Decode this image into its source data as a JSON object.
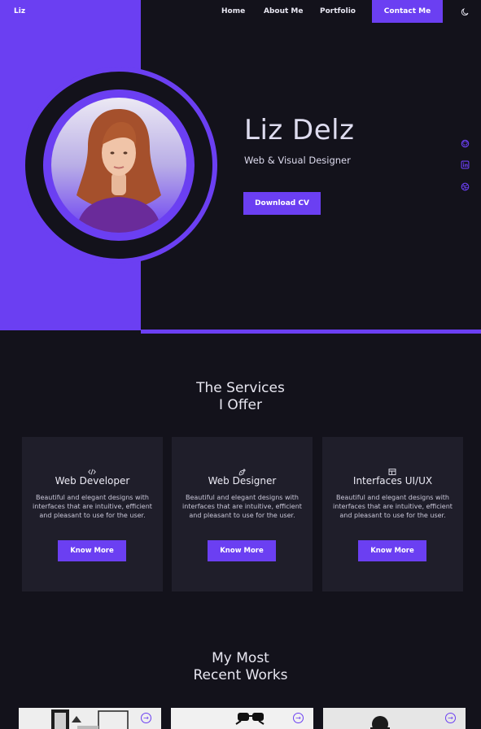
{
  "header": {
    "logo": "Liz",
    "nav": [
      "Home",
      "About Me",
      "Portfolio"
    ],
    "contact_label": "Contact Me",
    "theme_icon": "moon-icon"
  },
  "hero": {
    "name": "Liz Delz",
    "role": "Web & Visual Designer",
    "cta_label": "Download CV",
    "social_icons": [
      "github-icon",
      "linkedin-icon",
      "dribbble-icon"
    ]
  },
  "services": {
    "title_line1": "The Services",
    "title_line2": "I Offer",
    "cards": [
      {
        "icon": "code-icon",
        "title": "Web Developer",
        "text": "Beautiful and elegant designs with interfaces that are intuitive, efficient and pleasant to use for the user.",
        "button": "Know More"
      },
      {
        "icon": "pen-tool-icon",
        "title": "Web Designer",
        "text": "Beautiful and elegant designs with interfaces that are intuitive, efficient and pleasant to use for the user.",
        "button": "Know More"
      },
      {
        "icon": "layout-icon",
        "title": "Interfaces UI/UX",
        "text": "Beautiful and elegant designs with interfaces that are intuitive, efficient and pleasant to use for the user.",
        "button": "Know More"
      }
    ]
  },
  "works": {
    "title_line1": "My Most",
    "title_line2": "Recent Works",
    "items": [
      {
        "arrow_icon": "arrow-right-circle-icon"
      },
      {
        "arrow_icon": "arrow-right-circle-icon"
      },
      {
        "arrow_icon": "arrow-right-circle-icon"
      }
    ]
  },
  "colors": {
    "accent": "#6b3ff2",
    "background": "#13121b",
    "card": "#1f1e2a"
  }
}
